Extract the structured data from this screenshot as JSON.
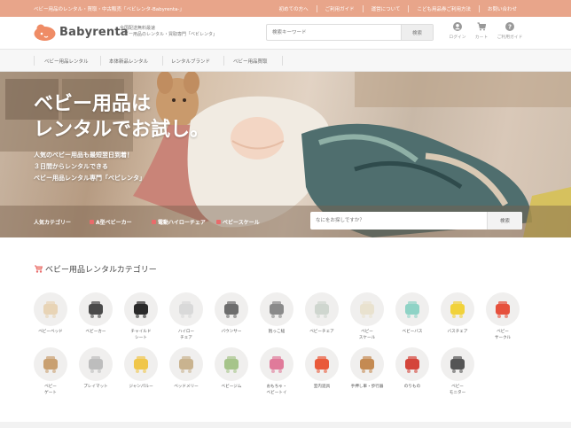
{
  "topbar": {
    "tagline": "ベビー用品のレンタル・買取・中古販売「ベビレンタ-Babyrenta-」",
    "links": [
      "初めての方へ",
      "ご利用ガイド",
      "運営について",
      "こども用品券ご利用方法",
      "お問い合わせ"
    ]
  },
  "header": {
    "logo_text": "Babyrenta",
    "logo_desc_1": "全国配送無料最速",
    "logo_desc_2": "ベビー用品のレンタル・買取専門「ベビレンタ」",
    "search_placeholder": "検索キーワード",
    "search_button": "検索",
    "icons": [
      {
        "icon": "user-icon",
        "label": "ログイン"
      },
      {
        "icon": "cart-icon",
        "label": "カート"
      },
      {
        "icon": "help-icon",
        "label": "ご利用ガイド"
      }
    ]
  },
  "nav": {
    "items": [
      "ベビー用品レンタル",
      "本体新品レンタル",
      "レンタルブランド",
      "ベビー用品買取"
    ]
  },
  "hero": {
    "title_line1": "ベビー用品は",
    "title_line2": "レンタルでお試し。",
    "sub_line1": "人気のベビー用品も最短翌日到着！",
    "sub_line2": "３日間からレンタルできる",
    "sub_line3": "ベビー用品レンタル専門「ベビレンタ」",
    "category_label": "人気カテゴリー",
    "quick_links": [
      "A型ベビーカー",
      "電動ハイローチェア",
      "ベビースケール"
    ],
    "search_placeholder": "なにをお探しですか？",
    "search_button": "検索"
  },
  "categories": {
    "title": "ベビー用品レンタルカテゴリー",
    "items": [
      {
        "label": "ベビーベッド",
        "icon": "baby-bed-icon"
      },
      {
        "label": "ベビーカー",
        "icon": "stroller-icon"
      },
      {
        "label": "チャイルド\nシート",
        "icon": "child-seat-icon"
      },
      {
        "label": "ハイロー\nチェア",
        "icon": "high-low-chair-icon"
      },
      {
        "label": "バウンサー",
        "icon": "bouncer-icon"
      },
      {
        "label": "抱っこ紐",
        "icon": "baby-carrier-icon"
      },
      {
        "label": "ベビーチェア",
        "icon": "baby-chair-icon"
      },
      {
        "label": "ベビー\nスケール",
        "icon": "baby-scale-icon"
      },
      {
        "label": "ベビーバス",
        "icon": "baby-bath-icon"
      },
      {
        "label": "バスチェア",
        "icon": "bath-chair-icon"
      },
      {
        "label": "ベビー\nサークル",
        "icon": "baby-circle-icon"
      },
      {
        "label": "ベビー\nゲート",
        "icon": "baby-gate-icon"
      },
      {
        "label": "プレイマット",
        "icon": "play-mat-icon"
      },
      {
        "label": "ジャンパルー",
        "icon": "jumperoo-icon"
      },
      {
        "label": "ベッドメリー",
        "icon": "bed-mobile-icon"
      },
      {
        "label": "ベビージム",
        "icon": "baby-gym-icon"
      },
      {
        "label": "おもちゃ・\nベビートイ",
        "icon": "toy-icon"
      },
      {
        "label": "室内遊具",
        "icon": "slide-icon"
      },
      {
        "label": "手押し車・歩行器",
        "icon": "walker-icon"
      },
      {
        "label": "のりもの",
        "icon": "ride-on-icon"
      },
      {
        "label": "ベビー\nモニター",
        "icon": "baby-monitor-icon"
      }
    ]
  },
  "colors": {
    "topbar": "#e8a58a",
    "accent": "#e96b6b",
    "logo": "#ef8c66"
  }
}
